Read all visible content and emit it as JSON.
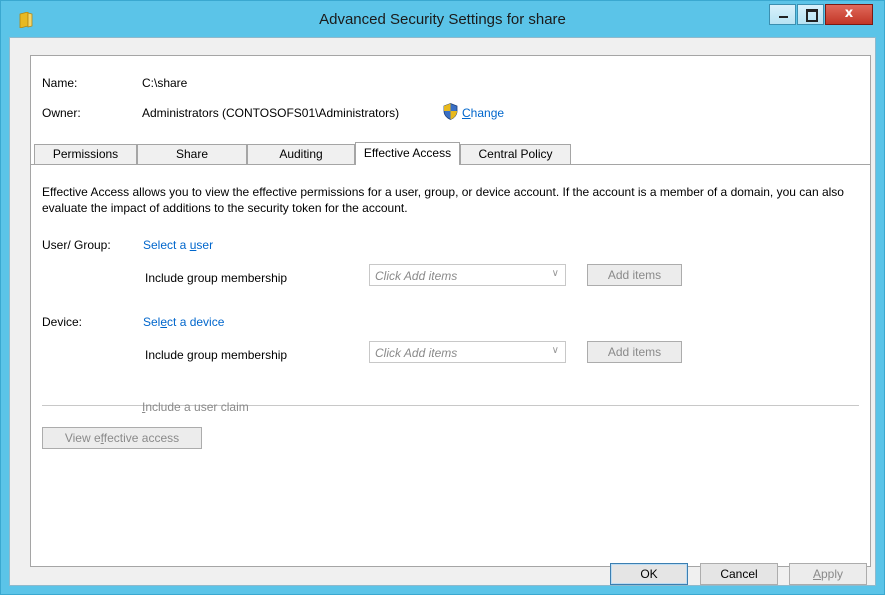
{
  "window": {
    "title": "Advanced Security Settings for share",
    "icon": "folder-icon",
    "caption": {
      "minimize": "minimize-icon",
      "maximize": "maximize-icon",
      "close": "close-icon",
      "close_glyph": "x"
    }
  },
  "info": {
    "name_label": "Name:",
    "name_value": "C:\\share",
    "owner_label": "Owner:",
    "owner_value": "Administrators (CONTOSOFS01\\Administrators)",
    "change_prefix": "",
    "change_accel": "C",
    "change_rest": "hange"
  },
  "tabs": [
    {
      "label": "Permissions",
      "active": false
    },
    {
      "label": "Share",
      "active": false
    },
    {
      "label": "Auditing",
      "active": false
    },
    {
      "label": "Effective Access",
      "active": true
    },
    {
      "label": "Central Policy",
      "active": false
    }
  ],
  "effective": {
    "description": "Effective Access allows you to view the effective permissions for a user, group, or device account. If the account is a member of a domain, you can also evaluate the impact of additions to the security token for the account.",
    "user_group_label": "User/ Group:",
    "select_user_pre": "Select a ",
    "select_user_accel": "u",
    "select_user_post": "ser",
    "user_membership_label": "Include group membership",
    "user_combo_placeholder": "Click Add items",
    "user_add_items": "Add items",
    "device_label": "Device:",
    "select_device_pre": "Sel",
    "select_device_accel": "e",
    "select_device_post": "ct a device",
    "device_membership_label": "Include group membership",
    "device_combo_placeholder": "Click Add items",
    "device_add_items": "Add items",
    "claim_pre": "",
    "claim_accel": "I",
    "claim_post": "nclude a user claim",
    "view_pre": "View e",
    "view_accel": "f",
    "view_post": "fective access"
  },
  "footer": {
    "ok": "OK",
    "cancel": "Cancel",
    "apply_accel": "A",
    "apply_rest": "pply"
  },
  "colors": {
    "titlebar": "#5bc4e8",
    "link": "#0066cc",
    "close_button": "#c23627",
    "disabled_text": "#8a8a8a"
  }
}
